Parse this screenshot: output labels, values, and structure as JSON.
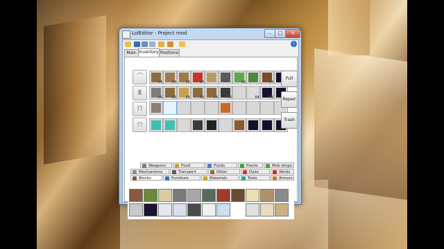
{
  "window": {
    "title": "LolEditor - Project mod"
  },
  "titlebar_buttons": {
    "minimize": "–",
    "maximize": "□",
    "close": "✕"
  },
  "toolbar": {
    "icons": [
      "folder-open-icon",
      "save-icon",
      "save-as-icon",
      "copy-icon",
      "folder-icon",
      "settings-icon",
      "tag-icon"
    ],
    "help": "i"
  },
  "tabs": [
    {
      "label": "Main"
    },
    {
      "label": "Inventory",
      "active": true
    },
    {
      "label": "Positions"
    }
  ],
  "armor_slots": [
    "helmet-slot",
    "chestplate-slot",
    "leggings-slot",
    "boots-slot"
  ],
  "armor_glyphs": {
    "helmet": "⌒",
    "chestplate": "♜",
    "leggings": "Π",
    "boots": "⊓"
  },
  "inventory": {
    "rows": [
      [
        {
          "item": "Arrow",
          "qty": "64",
          "color": "#8b6b3e"
        },
        {
          "item": "Stick",
          "qty": "64",
          "color": "#9e7b4a"
        },
        {
          "item": "Ladder",
          "qty": "64",
          "color": "#a07a40"
        },
        {
          "item": "TNT",
          "qty": "64",
          "color": "#c8322a"
        },
        {
          "item": "Painting",
          "qty": "",
          "color": "#b89a66"
        },
        {
          "item": "Minecart",
          "qty": "",
          "color": "#5a5a5a"
        },
        {
          "item": "Slime ball",
          "qty": "64",
          "color": "#5da84a"
        },
        {
          "item": "Seeds",
          "qty": "",
          "color": "#4a8a3a"
        },
        {
          "item": "Bookshelf",
          "qty": "64",
          "color": "#7a4a2a"
        },
        {
          "item": "Obsidian",
          "qty": "",
          "color": "#150f2a"
        }
      ],
      [
        {
          "item": "Cobblestone",
          "qty": "64",
          "color": "#7d7d7d"
        },
        {
          "item": "Arrow",
          "qty": "64",
          "color": "#8b6b3e"
        },
        {
          "item": "Torch",
          "qty": "64",
          "color": "#c9a04a"
        },
        {
          "item": "Arrow",
          "qty": "64",
          "color": "#8b6b3e"
        },
        {
          "item": "Arrow",
          "qty": "64",
          "color": "#8b6b3e"
        },
        {
          "item": "Flint",
          "qty": "64",
          "color": "#3a3a3a"
        },
        {
          "item": "Empty",
          "qty": "",
          "color": ""
        },
        {
          "item": "Cobweb",
          "qty": "64",
          "color": "#dcdcdc"
        },
        {
          "item": "Obsidian",
          "qty": "64",
          "color": "#1a1030"
        },
        {
          "item": "Obsidian",
          "qty": "64",
          "color": "#150f2a"
        }
      ],
      [
        {
          "item": "Gravel",
          "qty": "",
          "color": "#8a8078"
        },
        {
          "item": "Empty",
          "qty": "",
          "color": ""
        },
        {
          "item": "Empty",
          "qty": "",
          "color": ""
        },
        {
          "item": "Empty",
          "qty": "",
          "color": ""
        },
        {
          "item": "Empty",
          "qty": "",
          "color": ""
        },
        {
          "item": "Leather",
          "qty": "",
          "color": "#c8692a"
        },
        {
          "item": "Empty",
          "qty": "",
          "color": ""
        },
        {
          "item": "Empty",
          "qty": "",
          "color": ""
        },
        {
          "item": "Empty",
          "qty": "",
          "color": ""
        },
        {
          "item": "Empty",
          "qty": "",
          "color": ""
        }
      ],
      [
        {
          "item": "Diamond pickaxe",
          "qty": "",
          "color": "#3fbfb2"
        },
        {
          "item": "Diamond shovel",
          "qty": "",
          "color": "#3fbfb2"
        },
        {
          "item": "Empty",
          "qty": "",
          "color": ""
        },
        {
          "item": "Minecart",
          "qty": "",
          "color": "#3a3a3a"
        },
        {
          "item": "Coal",
          "qty": "",
          "color": "#222222"
        },
        {
          "item": "Empty",
          "qty": "",
          "color": ""
        },
        {
          "item": "Bow",
          "qty": "",
          "color": "#8b5a2b"
        },
        {
          "item": "Obsidian",
          "qty": "",
          "color": "#150f2a"
        },
        {
          "item": "Obsidian",
          "qty": "",
          "color": "#150f2a"
        },
        {
          "item": "Obsidian",
          "qty": "",
          "color": "#150f2a"
        }
      ]
    ]
  },
  "side_buttons": {
    "full": "Full",
    "repair": "Repair",
    "trash": "Trash"
  },
  "categories": {
    "row1": [
      {
        "label": "Weapons",
        "color": "#7a7a7a"
      },
      {
        "label": "Food",
        "color": "#c8a040"
      },
      {
        "label": "Fluids",
        "color": "#4a7ac8"
      },
      {
        "label": "Plants",
        "color": "#4a9a3a"
      },
      {
        "label": "Mob drops",
        "color": "#5a9a4a"
      }
    ],
    "row2": [
      {
        "label": "Mechanisms",
        "color": "#8a8a8a"
      },
      {
        "label": "Transport",
        "color": "#5a5a5a"
      },
      {
        "label": "Other",
        "color": "#8a6a40"
      },
      {
        "label": "Dyes",
        "color": "#c83a3a"
      },
      {
        "label": "Wools",
        "color": "#d8d8d8"
      }
    ],
    "row3": [
      {
        "label": "Blocks",
        "color": "#7a5a3a",
        "active": true
      },
      {
        "label": "Furniture",
        "color": "#c8a060"
      },
      {
        "label": "Materials",
        "color": "#d0a020"
      },
      {
        "label": "Tools",
        "color": "#2aa880"
      },
      {
        "label": "Armors",
        "color": "#c87a30"
      }
    ]
  },
  "palette_blocks": [
    [
      "#8a5a3e",
      "#6a8a3a",
      "#d8cca0",
      "#7a7a7a",
      "#a8a8a8",
      "#5a6a5a",
      "#a03a2a",
      "#6a4a30",
      "#e8e0b0",
      "#b0906a",
      "#8a8a8a"
    ],
    [
      "#c8c8c8",
      "#1a1430",
      "#e6e6f0",
      "#d8e0f0",
      "#4a4a4a",
      "#f0f0f0",
      "#c8e0f0",
      "",
      "#e0e0e0",
      "#e8dcc0",
      "#c8b080"
    ]
  ]
}
